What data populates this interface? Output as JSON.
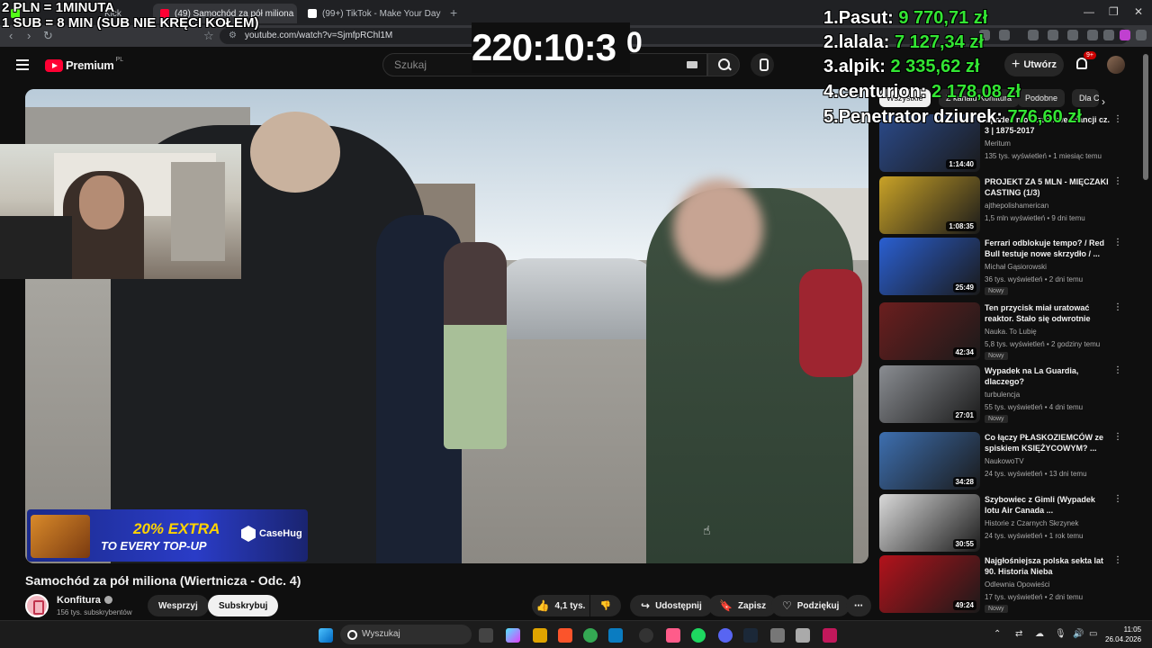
{
  "overlay": {
    "line1": "2 PLN = 1MINUTA",
    "line2": "1 SUB = 8 MIN (SUB NIE KRĘCI KOŁEM)",
    "timer": "220:10:3",
    "timer_sup": "0",
    "leaderboard": [
      {
        "rank": "1.",
        "name": "Pasut:",
        "amount": "9 770,71 zł"
      },
      {
        "rank": "2.",
        "name": "lalala:",
        "amount": "7 127,34 zł"
      },
      {
        "rank": "3.",
        "name": "alpik:",
        "amount": "2 335,62 zł"
      },
      {
        "rank": "4.",
        "name": "centurion:",
        "amount": "2 178,08 zł"
      },
      {
        "rank": "5.",
        "name": "Penetrator dziurek:",
        "amount": "776,60 zł"
      }
    ]
  },
  "browser": {
    "tabs": [
      {
        "title": "Kick",
        "color": "#53fc18"
      },
      {
        "title": "(49) Samochód za pół miliona",
        "color": "#ff0033"
      },
      {
        "title": "(99+) TikTok - Make Your Day",
        "color": "#ffffff"
      }
    ],
    "url": "youtube.com/watch?v=SjmfpRChl1M"
  },
  "youtube": {
    "logo": "Premium",
    "region": "PL",
    "search_placeholder": "Szukaj",
    "create_label": "Utwórz",
    "notifications": "9+"
  },
  "ad": {
    "extra": "20% EXTRA",
    "topup": "TO EVERY TOP-UP",
    "brand": "CaseHug"
  },
  "video": {
    "title": "Samochód za pół miliona (Wiertnicza - Odc. 4)",
    "channel": "Konfitura",
    "subscribers": "156 tys. subskrybentów",
    "support_label": "Wesprzyj",
    "subscribe_label": "Subskrybuj",
    "likes": "4,1 tys.",
    "share_label": "Udostępnij",
    "save_label": "Zapisz",
    "thanks_label": "Podziękuj"
  },
  "chips": [
    "Wszystkie",
    "Z kanału Konfitura",
    "Podobne",
    "Dla Ciebie"
  ],
  "recommendations": [
    {
      "title": "Upadek monarchii we Francji cz. 3 | 1875-2017",
      "channel": "Meritum",
      "meta": "135 tys. wyświetleń • 1 miesiąc temu",
      "duration": "1:14:40",
      "new": "",
      "thumb": "#2b4a8a"
    },
    {
      "title": "PROJEKT ZA 5 MLN - MIĘCZAKI CASTING (1/3)",
      "channel": "ajthepolishamerican",
      "meta": "1,5 mln wyświetleń • 9 dni temu",
      "duration": "1:08:35",
      "new": "",
      "thumb": "#c9a227"
    },
    {
      "title": "Ferrari odblokuje tempo? / Red Bull testuje nowe skrzydło / ...",
      "channel": "Michał Gąsiorowski",
      "meta": "36 tys. wyświetleń • 2 dni temu",
      "duration": "25:49",
      "new": "Nowy",
      "thumb": "#2a5fd1"
    },
    {
      "title": "Ten przycisk miał uratować reaktor. Stało się odwrotnie",
      "channel": "Nauka. To Lubię",
      "meta": "5,8 tys. wyświetleń • 2 godziny temu",
      "duration": "42:34",
      "new": "Nowy",
      "thumb": "#6b1e1e"
    },
    {
      "title": "Wypadek na La Guardia, dlaczego?",
      "channel": "turbulencja",
      "meta": "55 tys. wyświetleń • 4 dni temu",
      "duration": "27:01",
      "new": "Nowy",
      "thumb": "#8a8d92"
    },
    {
      "title": "Co łączy PŁASKOZIEMCÓW ze spiskiem KSIĘŻYCOWYM? ...",
      "channel": "NaukowoTV",
      "meta": "24 tys. wyświetleń • 13 dni temu",
      "duration": "34:28",
      "new": "",
      "thumb": "#3d6fb0"
    },
    {
      "title": "Szybowiec z Gimli (Wypadek lotu Air Canada ...",
      "channel": "Historie z Czarnych Skrzynek",
      "meta": "24 tys. wyświetleń • 1 rok temu",
      "duration": "30:55",
      "new": "",
      "thumb": "#d9d9d9"
    },
    {
      "title": "Najgłośniejsza polska sekta lat 90. Historia Nieba",
      "channel": "Odlewnia Opowieści",
      "meta": "17 tys. wyświetleń • 2 dni temu",
      "duration": "49:24",
      "new": "Nowy",
      "thumb": "#b3121b"
    }
  ],
  "taskbar": {
    "search_placeholder": "Wyszukaj",
    "time": "11:05",
    "date": "26.04.2026"
  }
}
